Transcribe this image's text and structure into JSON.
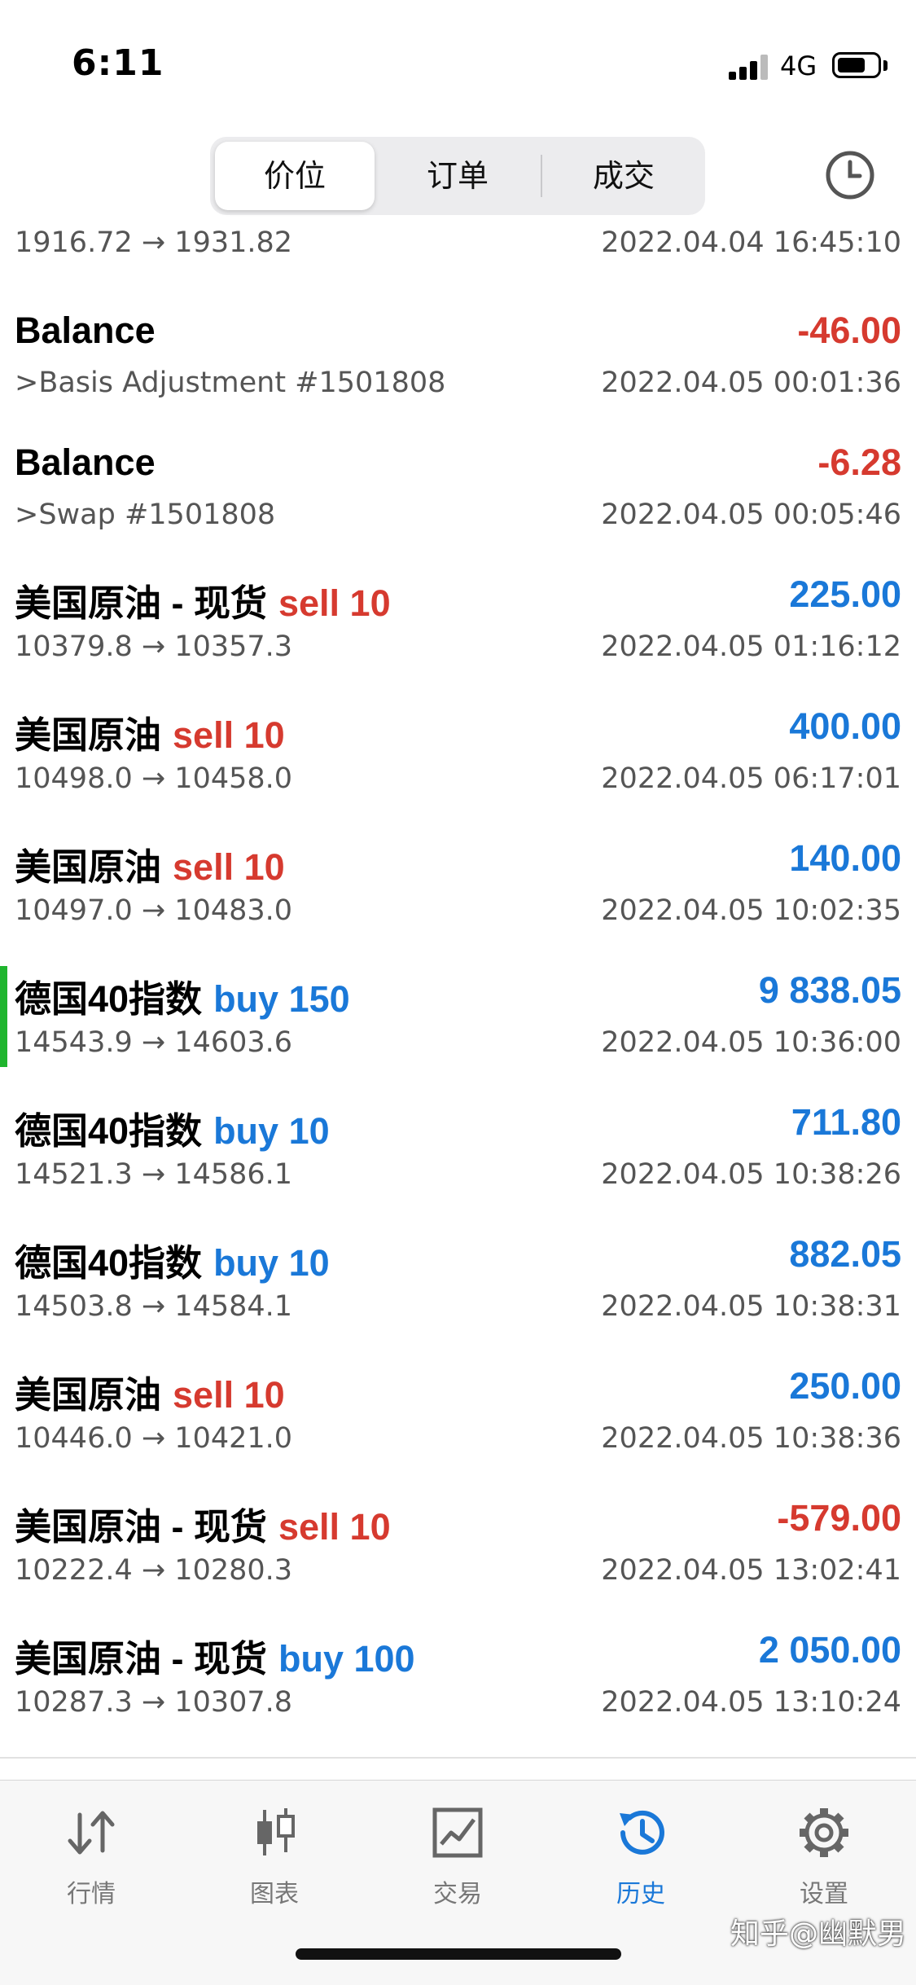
{
  "status_bar": {
    "time": "6:11",
    "network": "4G",
    "battery_level": 0.72
  },
  "segmented": {
    "tabs": [
      "价位",
      "订单",
      "成交"
    ],
    "active": "价位"
  },
  "clip_row": {
    "sub": "1916.72 → 1931.82",
    "time": "2022.04.04 16:45:10"
  },
  "rows": [
    {
      "title": "Balance",
      "side": "",
      "amount": "-46.00",
      "sub": ">Basis Adjustment #1501808",
      "time": "2022.04.05 00:01:36"
    },
    {
      "title": "Balance",
      "side": "",
      "amount": "-6.28",
      "sub": ">Swap #1501808",
      "time": "2022.04.05 00:05:46"
    },
    {
      "title": "美国原油 - 现货",
      "side": "sell 10",
      "amount": "225.00",
      "sub": "10379.8 → 10357.3",
      "time": "2022.04.05 01:16:12"
    },
    {
      "title": "美国原油",
      "side": "sell 10",
      "amount": "400.00",
      "sub": "10498.0 → 10458.0",
      "time": "2022.04.05 06:17:01"
    },
    {
      "title": "美国原油",
      "side": "sell 10",
      "amount": "140.00",
      "sub": "10497.0 → 10483.0",
      "time": "2022.04.05 10:02:35"
    },
    {
      "title": "德国40指数",
      "side": "buy 150",
      "amount": "9 838.05",
      "sub": "14543.9 → 14603.6",
      "time": "2022.04.05 10:36:00"
    },
    {
      "title": "德国40指数",
      "side": "buy 10",
      "amount": "711.80",
      "sub": "14521.3 → 14586.1",
      "time": "2022.04.05 10:38:26"
    },
    {
      "title": "德国40指数",
      "side": "buy 10",
      "amount": "882.05",
      "sub": "14503.8 → 14584.1",
      "time": "2022.04.05 10:38:31"
    },
    {
      "title": "美国原油",
      "side": "sell 10",
      "amount": "250.00",
      "sub": "10446.0 → 10421.0",
      "time": "2022.04.05 10:38:36"
    },
    {
      "title": "美国原油 - 现货",
      "side": "sell 10",
      "amount": "-579.00",
      "sub": "10222.4 → 10280.3",
      "time": "2022.04.05 13:02:41"
    },
    {
      "title": "美国原油 - 现货",
      "side": "buy 100",
      "amount": "2 050.00",
      "sub": "10287.3 → 10307.8",
      "time": "2022.04.05 13:10:24"
    }
  ],
  "tabbar": {
    "items": [
      {
        "label": "行情",
        "icon": "quotes-arrows-icon"
      },
      {
        "label": "图表",
        "icon": "candlestick-chart-icon"
      },
      {
        "label": "交易",
        "icon": "trade-chart-icon"
      },
      {
        "label": "历史",
        "icon": "history-clock-icon"
      },
      {
        "label": "设置",
        "icon": "gear-icon"
      }
    ],
    "active": "历史"
  },
  "watermark": "知乎@幽默男",
  "colors": {
    "accent": "#1a78d8",
    "negative": "#d63a2f",
    "highlight_marker": "#1fb52e"
  }
}
